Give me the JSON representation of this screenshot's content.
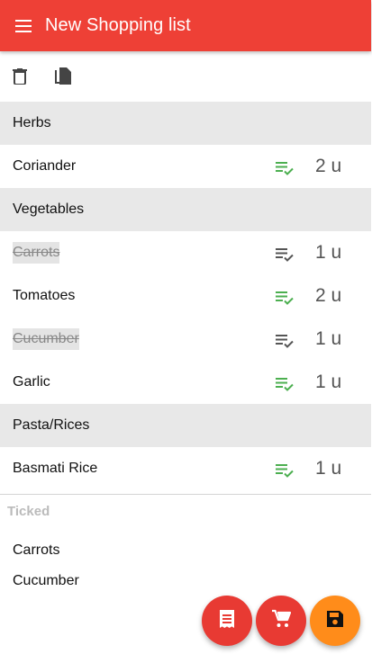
{
  "appbar": {
    "title": "New Shopping list",
    "color": "#ee4036"
  },
  "toolbar": {
    "icons": [
      "delete-icon",
      "copy-icon"
    ]
  },
  "categories": [
    {
      "name": "Herbs",
      "items": [
        {
          "name": "Coriander",
          "qty": "2 u",
          "checked": false
        }
      ]
    },
    {
      "name": "Vegetables",
      "items": [
        {
          "name": "Carrots",
          "qty": "1 u",
          "checked": true
        },
        {
          "name": "Tomatoes",
          "qty": "2 u",
          "checked": false
        },
        {
          "name": "Cucumber",
          "qty": "1 u",
          "checked": true
        },
        {
          "name": "Garlic",
          "qty": "1 u",
          "checked": false
        }
      ]
    },
    {
      "name": "Pasta/Rices",
      "items": [
        {
          "name": "Basmati Rice",
          "qty": "1 u",
          "checked": false
        }
      ]
    }
  ],
  "ticked": {
    "header": "Ticked",
    "items": [
      "Carrots",
      "Cucumber"
    ]
  },
  "fabs": [
    {
      "icon": "receipt-icon",
      "color": "#e83a33"
    },
    {
      "icon": "cart-icon",
      "color": "#e83a33"
    },
    {
      "icon": "save-icon",
      "color": "#ff8c1a"
    }
  ],
  "colors": {
    "note_active": "#4caf50",
    "note_inactive": "#555555"
  }
}
